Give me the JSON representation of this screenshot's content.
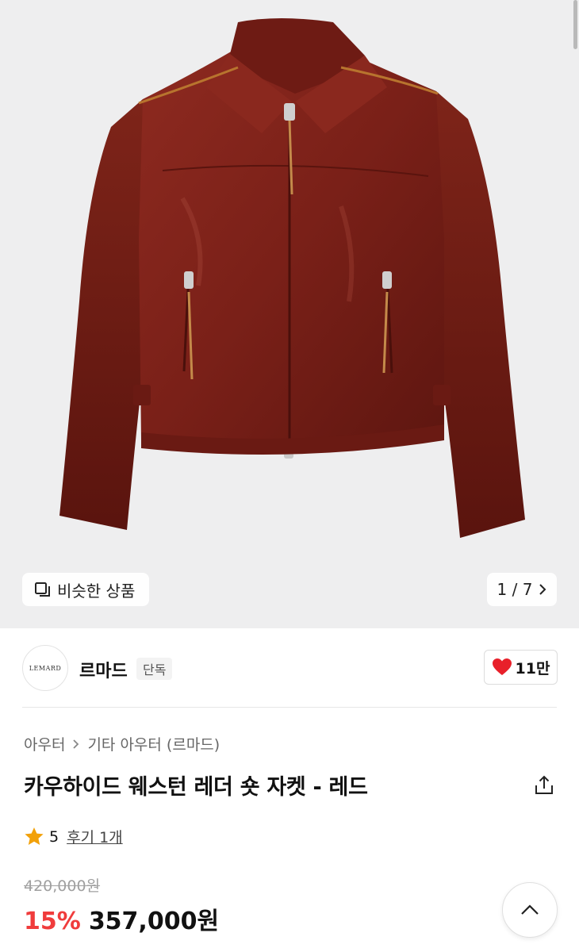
{
  "gallery": {
    "similar_label": "비슷한 상품",
    "page_indicator": "1 / 7",
    "current_page": 1,
    "total_pages": 7,
    "image_alt": "jacket-photo",
    "background_color": "#eeeeef"
  },
  "brand": {
    "logo_text": "LEMARD",
    "name": "르마드",
    "badge": "단독",
    "likes": "11만",
    "heart_color": "#e8202a"
  },
  "product": {
    "breadcrumb": [
      "아우터",
      "기타 아우터 (르마드)"
    ],
    "title": "카우하이드 웨스턴 레더 숏 자켓 - 레드",
    "rating_score": "5",
    "reviews_label": "후기 1개",
    "star_color": "#f2a10a",
    "original_price": "420,000원",
    "discount": "15%",
    "discount_color": "#f03c3c",
    "sale_price": "357,000원"
  },
  "icons": {
    "similar": "similar-products-icon",
    "page_next": "chevron-right-icon",
    "heart": "heart-icon",
    "breadcrumb_sep": "chevron-right-icon",
    "share": "share-icon",
    "star": "star-icon",
    "scroll_top": "chevron-up-icon"
  }
}
